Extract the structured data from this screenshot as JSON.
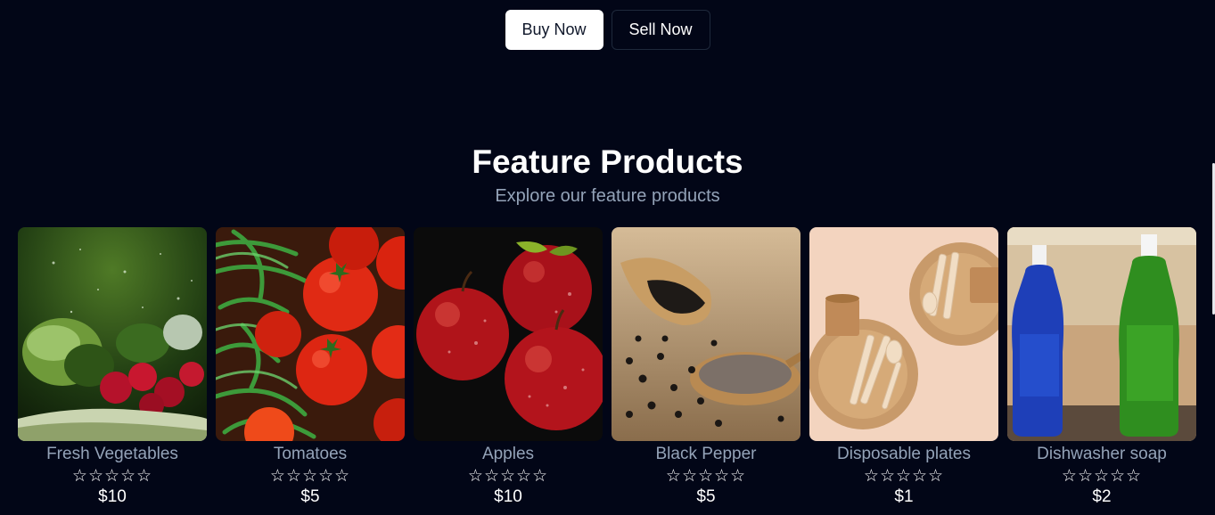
{
  "actions": {
    "buy_label": "Buy Now",
    "sell_label": "Sell Now"
  },
  "featured": {
    "title": "Feature Products",
    "subtitle": "Explore our feature products"
  },
  "products": [
    {
      "name": "Fresh Vegetables",
      "price": "$10",
      "rating": "☆☆☆☆☆",
      "image": "fresh-vegetables-photo"
    },
    {
      "name": "Tomatoes",
      "price": "$5",
      "rating": "☆☆☆☆☆",
      "image": "tomatoes-photo"
    },
    {
      "name": "Apples",
      "price": "$10",
      "rating": "☆☆☆☆☆",
      "image": "apples-photo"
    },
    {
      "name": "Black Pepper",
      "price": "$5",
      "rating": "☆☆☆☆☆",
      "image": "black-pepper-photo"
    },
    {
      "name": "Disposable plates",
      "price": "$1",
      "rating": "☆☆☆☆☆",
      "image": "disposable-plates-photo"
    },
    {
      "name": "Dishwasher soap",
      "price": "$2",
      "rating": "☆☆☆☆☆",
      "image": "dishwasher-soap-photo"
    }
  ],
  "colors": {
    "background": "#020617",
    "muted_text": "#94a3b8",
    "button_light": "#ffffff",
    "button_border": "#1e293b"
  }
}
